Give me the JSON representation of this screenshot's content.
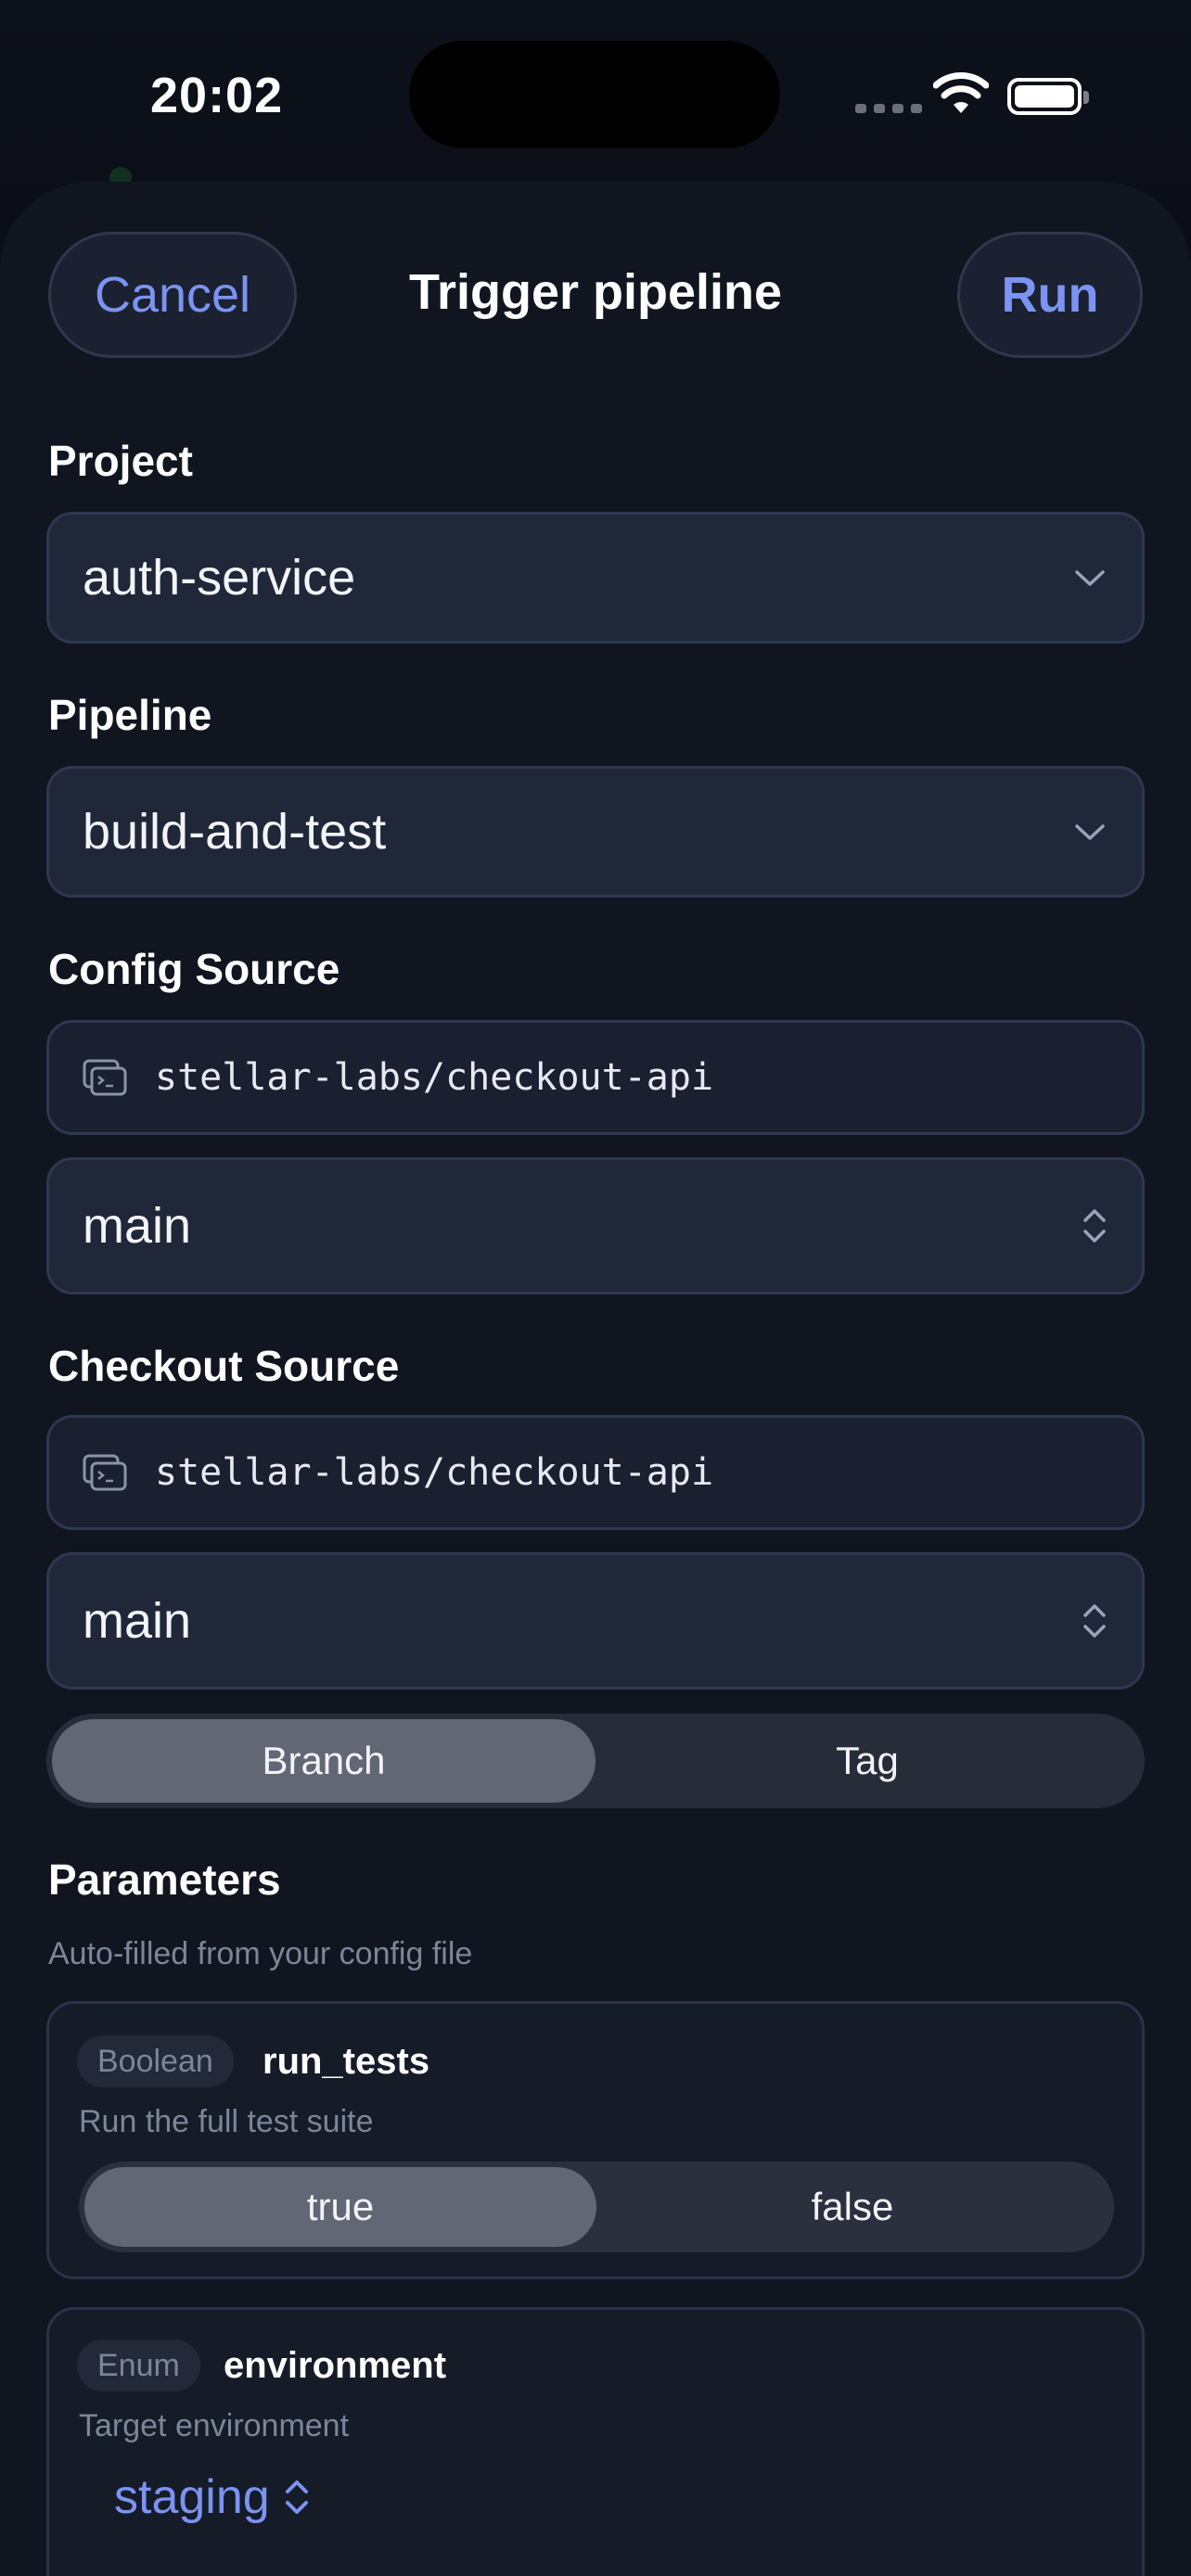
{
  "status_bar": {
    "time": "20:02"
  },
  "header": {
    "cancel_label": "Cancel",
    "title": "Trigger pipeline",
    "run_label": "Run"
  },
  "project": {
    "label": "Project",
    "value": "auth-service"
  },
  "pipeline": {
    "label": "Pipeline",
    "value": "build-and-test"
  },
  "config_source": {
    "label": "Config Source",
    "repo": "stellar-labs/checkout-api",
    "branch": "main"
  },
  "checkout_source": {
    "label": "Checkout Source",
    "repo": "stellar-labs/checkout-api",
    "ref": "main",
    "ref_type_options": [
      "Branch",
      "Tag"
    ],
    "ref_type_selected": "Branch"
  },
  "parameters": {
    "label": "Parameters",
    "hint": "Auto-filled from your config file",
    "items": [
      {
        "type": "Boolean",
        "name": "run_tests",
        "description": "Run the full test suite",
        "options": [
          "true",
          "false"
        ],
        "selected": "true"
      },
      {
        "type": "Enum",
        "name": "environment",
        "description": "Target environment",
        "value": "staging"
      }
    ]
  },
  "colors": {
    "accent": "#7b93f2",
    "background": "#0b0e16",
    "sheet": "#11151f",
    "field": "#202739"
  }
}
